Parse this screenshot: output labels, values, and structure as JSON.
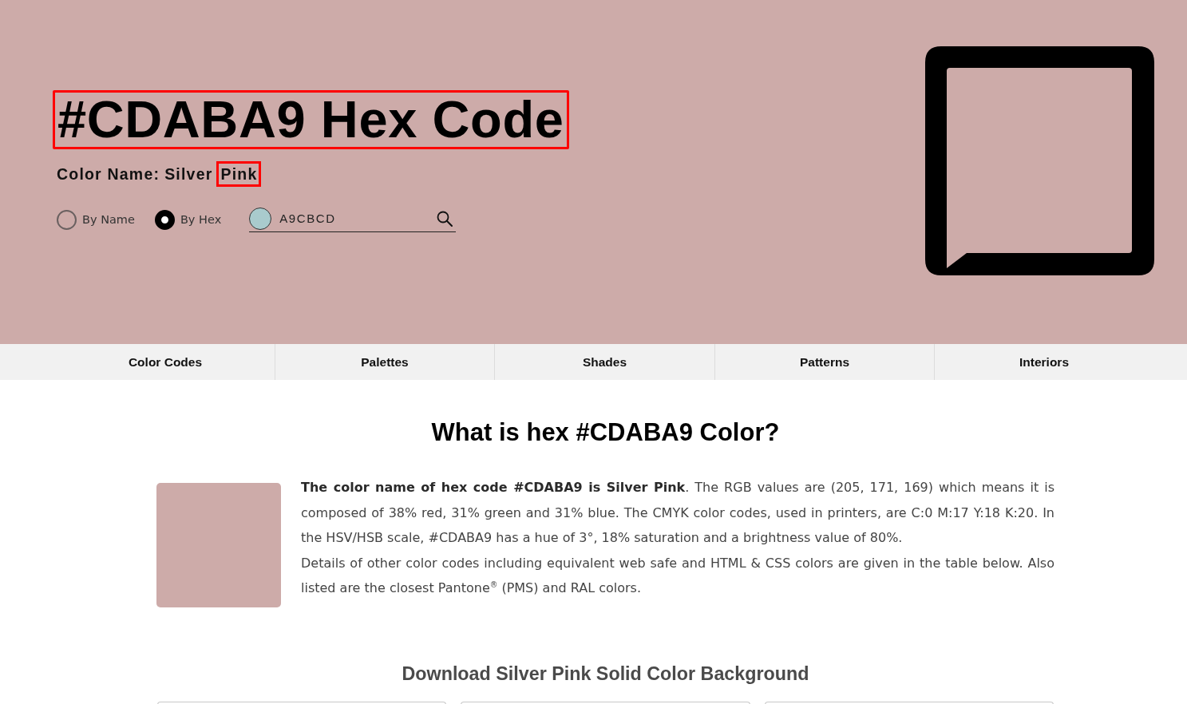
{
  "header": {
    "title": {
      "text": "#CDABA9 Hex Code",
      "highlighted": true
    },
    "color_name": {
      "label": "Color Name:",
      "words": [
        {
          "text": "Silver",
          "highlighted": false
        },
        {
          "text": "Pink",
          "highlighted": true
        }
      ]
    },
    "search_modes": [
      {
        "label": "By Name",
        "selected": false
      },
      {
        "label": "By Hex",
        "selected": true
      }
    ],
    "search": {
      "value": "A9CBCD"
    }
  },
  "nav": {
    "tabs": [
      {
        "label": "Color Codes"
      },
      {
        "label": "Palettes"
      },
      {
        "label": "Shades"
      },
      {
        "label": "Patterns"
      },
      {
        "label": "Interiors"
      }
    ]
  },
  "main": {
    "heading": "What is hex #CDABA9 Color?",
    "paragraphs": [
      "**The color name of hex code #CDABA9 is Silver Pink**. The RGB values are (205, 171, 169) which means it is composed of 38% red, 31% green and 31% blue. The CMYK color codes, used in printers, are C:0 M:17 Y:18 K:20. In the HSV/HSB scale, #CDABA9 has a hue of 3°, 18% saturation and a brightness value of 80%.",
      "Details of other color codes including equivalent web safe and HTML & CSS colors are given in the table below. Also listed are the closest Pantone$^{®}$ (PMS) and RAL colors."
    ],
    "download": {
      "heading": "Download Silver Pink Solid Color Background",
      "cards": [
        {
          "kind": "preview"
        },
        {
          "kind": "preview"
        },
        {
          "kind": "preview"
        }
      ]
    }
  }
}
